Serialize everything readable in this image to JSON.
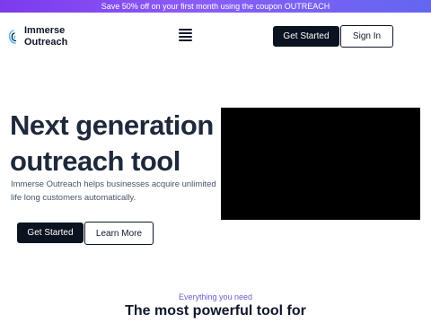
{
  "promo": {
    "text": "Save 50% off on your first month using the coupon OUTREACH"
  },
  "logo": {
    "line1": "Immerse",
    "line2": "Outreach"
  },
  "nav": {
    "get_started": "Get Started",
    "sign_in": "Sign In",
    "menu_icon": "hamburger-menu-icon"
  },
  "hero": {
    "title": "Next generation outreach tool",
    "description": "Immerse Outreach helps businesses acquire unlimited life long customers automatically.",
    "get_started": "Get Started",
    "learn_more": "Learn More"
  },
  "section": {
    "eyebrow": "Everything you need",
    "title": "The most powerful tool for"
  },
  "colors": {
    "dark": "#0b1220",
    "promo_start": "#7c3aed",
    "promo_end": "#6366f1",
    "eyebrow": "#6d5bd0"
  }
}
